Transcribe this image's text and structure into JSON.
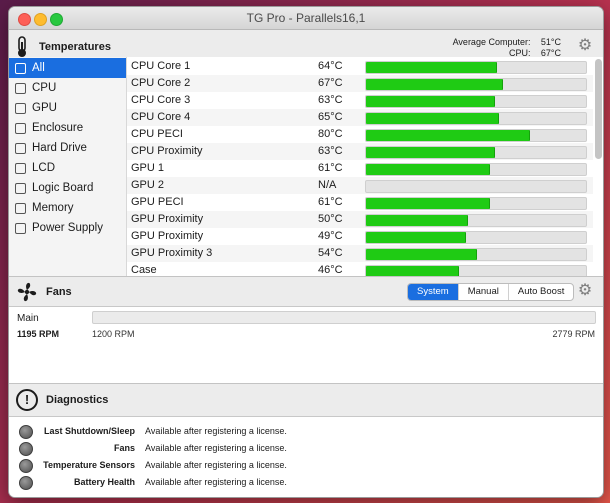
{
  "window": {
    "title": "TG Pro - Parallels16,1"
  },
  "temperatures": {
    "heading": "Temperatures",
    "average_label": "Average Computer:",
    "average_value": "51°C",
    "cpu_label": "CPU:",
    "cpu_value": "67°C",
    "sidebar": [
      {
        "label": "All",
        "icon": "display-icon",
        "selected": true
      },
      {
        "label": "CPU",
        "icon": "cpu-icon",
        "selected": false
      },
      {
        "label": "GPU",
        "icon": "gpu-icon",
        "selected": false
      },
      {
        "label": "Enclosure",
        "icon": "enclosure-icon",
        "selected": false
      },
      {
        "label": "Hard Drive",
        "icon": "hard-drive-icon",
        "selected": false
      },
      {
        "label": "LCD",
        "icon": "lcd-icon",
        "selected": false
      },
      {
        "label": "Logic Board",
        "icon": "logic-board-icon",
        "selected": false
      },
      {
        "label": "Memory",
        "icon": "memory-icon",
        "selected": false
      },
      {
        "label": "Power Supply",
        "icon": "power-icon",
        "selected": false
      }
    ],
    "sensors": [
      {
        "name": "CPU Core 1",
        "temp": "64°C",
        "level": 0.59
      },
      {
        "name": "CPU Core 2",
        "temp": "67°C",
        "level": 0.62
      },
      {
        "name": "CPU Core 3",
        "temp": "63°C",
        "level": 0.58
      },
      {
        "name": "CPU Core 4",
        "temp": "65°C",
        "level": 0.6
      },
      {
        "name": "CPU PECI",
        "temp": "80°C",
        "level": 0.74
      },
      {
        "name": "CPU Proximity",
        "temp": "63°C",
        "level": 0.58
      },
      {
        "name": "GPU 1",
        "temp": "61°C",
        "level": 0.56
      },
      {
        "name": "GPU 2",
        "temp": "N/A",
        "level": 0
      },
      {
        "name": "GPU PECI",
        "temp": "61°C",
        "level": 0.56
      },
      {
        "name": "GPU Proximity",
        "temp": "50°C",
        "level": 0.46
      },
      {
        "name": "GPU Proximity",
        "temp": "49°C",
        "level": 0.45
      },
      {
        "name": "GPU Proximity 3",
        "temp": "54°C",
        "level": 0.5
      },
      {
        "name": "Case",
        "temp": "46°C",
        "level": 0.42
      }
    ]
  },
  "fans": {
    "heading": "Fans",
    "modes": [
      {
        "label": "System",
        "active": true
      },
      {
        "label": "Manual",
        "active": false
      },
      {
        "label": "Auto Boost",
        "active": false
      }
    ],
    "items": [
      {
        "name": "Main",
        "rpm": "1195 RPM",
        "min": "1200 RPM",
        "max": "2779 RPM",
        "level": 0
      }
    ]
  },
  "diagnostics": {
    "heading": "Diagnostics",
    "items": [
      {
        "label": "Last Shutdown/Sleep",
        "value": "Available after registering a license."
      },
      {
        "label": "Fans",
        "value": "Available after registering a license."
      },
      {
        "label": "Temperature Sensors",
        "value": "Available after registering a license."
      },
      {
        "label": "Battery Health",
        "value": "Available after registering a license."
      }
    ]
  },
  "colors": {
    "accent": "#1a6ee0",
    "bar_green": "#1fcb14",
    "status_gray": "#5a5a5a"
  }
}
